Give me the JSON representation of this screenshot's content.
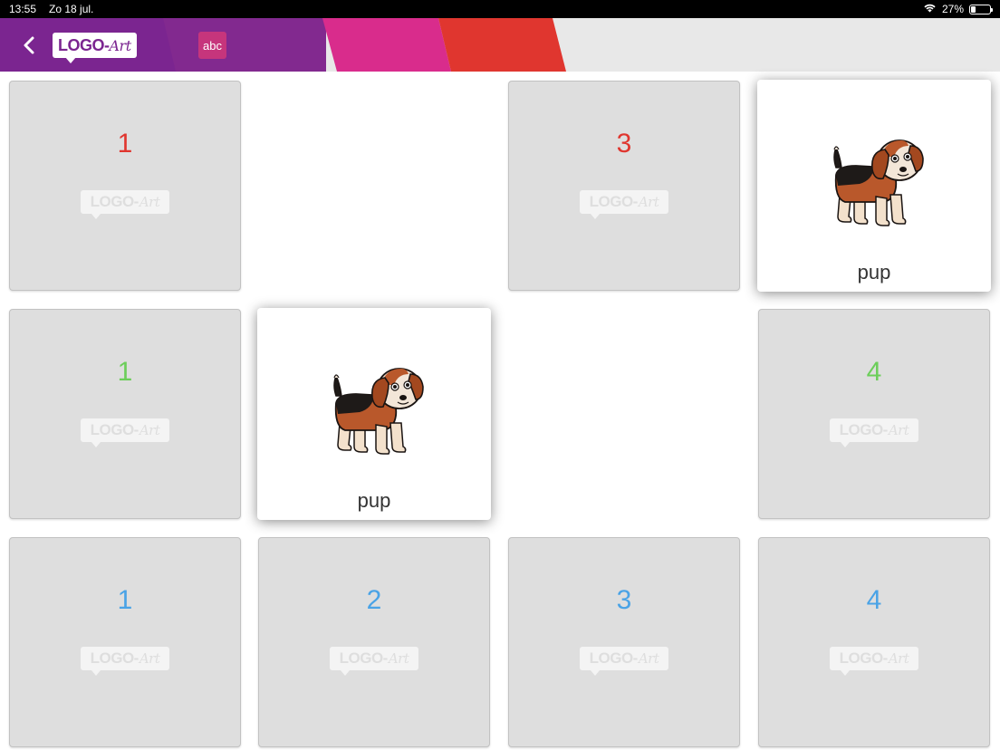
{
  "status_bar": {
    "time": "13:55",
    "date": "Zo 18 jul.",
    "battery": "27%",
    "battery_level": 0.27
  },
  "header": {
    "logo_main": "LOGO-",
    "logo_art": "Art",
    "abc_label": "abc",
    "colors": {
      "purple": "#7b2590",
      "pink": "#d92c8c",
      "red": "#e0362f",
      "gray": "#e8e8e8"
    }
  },
  "watermark": {
    "main": "LOGO-",
    "art": "Art"
  },
  "cards": [
    {
      "state": "back",
      "number": "1",
      "color": "#e0362f"
    },
    {
      "state": "empty"
    },
    {
      "state": "back",
      "number": "3",
      "color": "#e0362f"
    },
    {
      "state": "front",
      "word": "pup",
      "icon": "beagle-puppy"
    },
    {
      "state": "back",
      "number": "1",
      "color": "#6cce5a"
    },
    {
      "state": "front",
      "word": "pup",
      "icon": "beagle-puppy"
    },
    {
      "state": "empty"
    },
    {
      "state": "back",
      "number": "4",
      "color": "#6cce5a"
    },
    {
      "state": "back",
      "number": "1",
      "color": "#4aa3e6"
    },
    {
      "state": "back",
      "number": "2",
      "color": "#4aa3e6"
    },
    {
      "state": "back",
      "number": "3",
      "color": "#4aa3e6"
    },
    {
      "state": "back",
      "number": "4",
      "color": "#4aa3e6"
    }
  ]
}
